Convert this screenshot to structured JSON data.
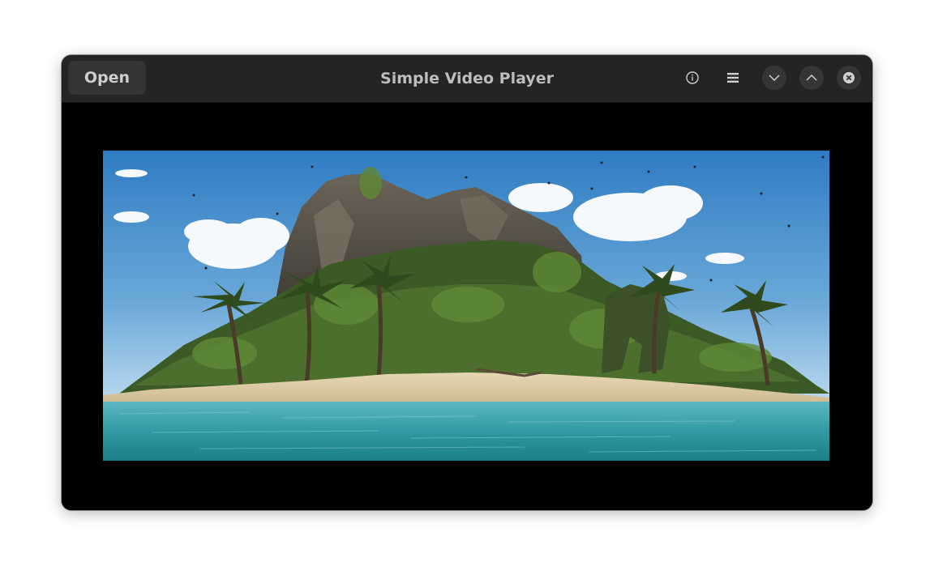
{
  "window": {
    "title": "Simple Video Player"
  },
  "headerbar": {
    "open_label": "Open",
    "icons": {
      "info": "info-icon",
      "menu": "hamburger-menu-icon",
      "minimize": "chevron-down-icon",
      "maximize": "chevron-up-icon",
      "close": "close-icon"
    }
  },
  "video": {
    "scene": "tropical island with rocky cliff, palm trees, sandy beach and turquoise water"
  },
  "colors": {
    "headerbar_bg": "#242424",
    "button_bg": "#343434",
    "title_text": "#bdbdbd",
    "video_bg": "#000000"
  }
}
